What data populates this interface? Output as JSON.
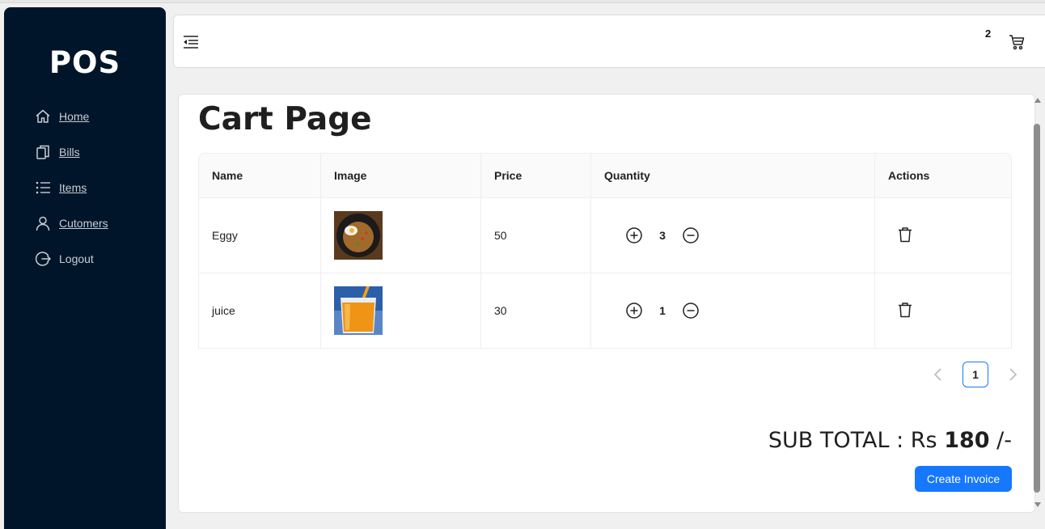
{
  "sidebar": {
    "logo": "POS",
    "items": [
      {
        "label": "Home",
        "icon": "home-icon"
      },
      {
        "label": "Bills",
        "icon": "copy-icon"
      },
      {
        "label": "Items",
        "icon": "list-icon"
      },
      {
        "label": "Cutomers",
        "icon": "user-icon"
      },
      {
        "label": "Logout",
        "icon": "logout-icon"
      }
    ]
  },
  "header": {
    "cart_count": "2"
  },
  "main": {
    "title": "Cart Page",
    "table": {
      "columns": [
        "Name",
        "Image",
        "Price",
        "Quantity",
        "Actions"
      ],
      "rows": [
        {
          "name": "Eggy",
          "image": "egg-dish-image",
          "price": "50",
          "quantity": "3"
        },
        {
          "name": "juice",
          "image": "orange-juice-image",
          "price": "30",
          "quantity": "1"
        }
      ]
    },
    "pagination": {
      "current_page": "1"
    },
    "subtotal": {
      "label": "SUB TOTAL : Rs ",
      "amount": "180",
      "suffix": " /-"
    },
    "create_invoice_label": "Create Invoice"
  },
  "colors": {
    "sidebar_bg": "#001529",
    "primary": "#1677ff"
  }
}
